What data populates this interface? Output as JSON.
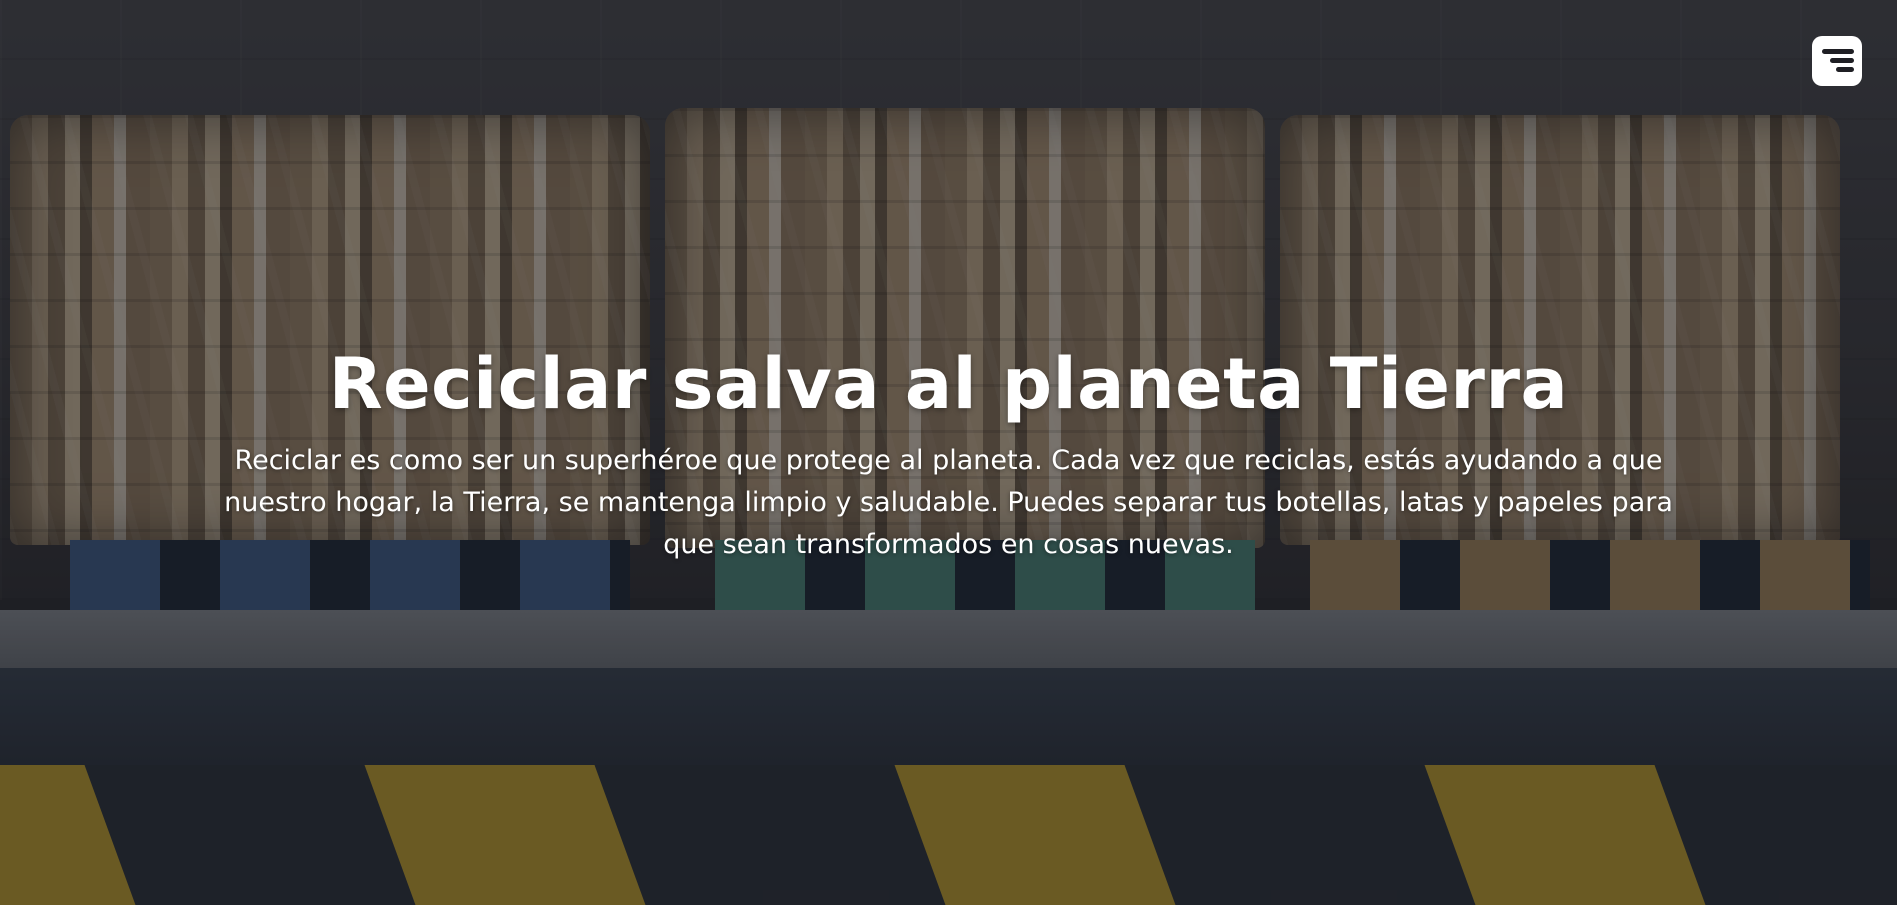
{
  "hero": {
    "title": "Reciclar salva al planeta Tierra",
    "description": "Reciclar es como ser un superhéroe que protege al planeta. Cada vez que reciclas, estás ayudando a que nuestro hogar, la Tierra, se mantenga limpio y saludable. Puedes separar tus botellas, latas y papeles para que sean transformados en cosas nuevas."
  },
  "header": {
    "menu_icon": "hamburger-menu-icon"
  },
  "colors": {
    "text": "#ffffff",
    "menu_button_bg": "#ffffff",
    "menu_icon": "#1f1f24",
    "overlay": "rgba(20, 22, 28, 0.52)"
  }
}
